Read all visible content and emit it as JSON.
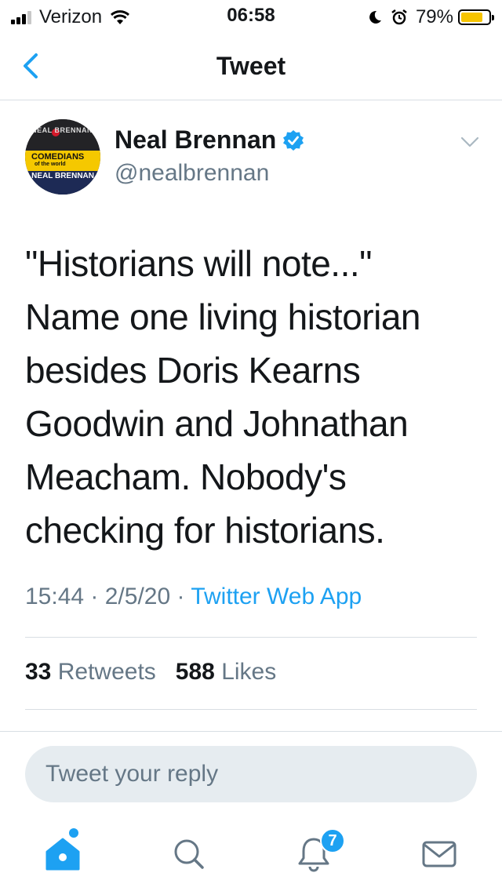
{
  "status_bar": {
    "carrier": "Verizon",
    "time": "06:58",
    "battery": "79%",
    "battery_level": 0.79
  },
  "nav": {
    "title": "Tweet"
  },
  "tweet": {
    "author": {
      "display_name": "Neal Brennan",
      "handle": "@nealbrennan",
      "verified": true,
      "avatar_text": {
        "top": "NEAL BRENNAN",
        "band": "COMEDIANS",
        "band_sub": "of the world",
        "bottom": "NEAL BRENNAN"
      }
    },
    "text_lines": [
      "\"Historians will note...\"",
      "Name one living historian",
      "besides Doris Kearns",
      "Goodwin and Johnathan",
      "Meacham.  Nobody's",
      "checking for historians."
    ],
    "time": "15:44",
    "date": "2/5/20",
    "source": "Twitter Web App",
    "retweets_count": "33",
    "retweets_label": "Retweets",
    "likes_count": "588",
    "likes_label": "Likes"
  },
  "reply": {
    "placeholder": "Tweet your reply"
  },
  "tabbar": {
    "notifications_badge": "7",
    "accent_color": "#1da1f2"
  }
}
